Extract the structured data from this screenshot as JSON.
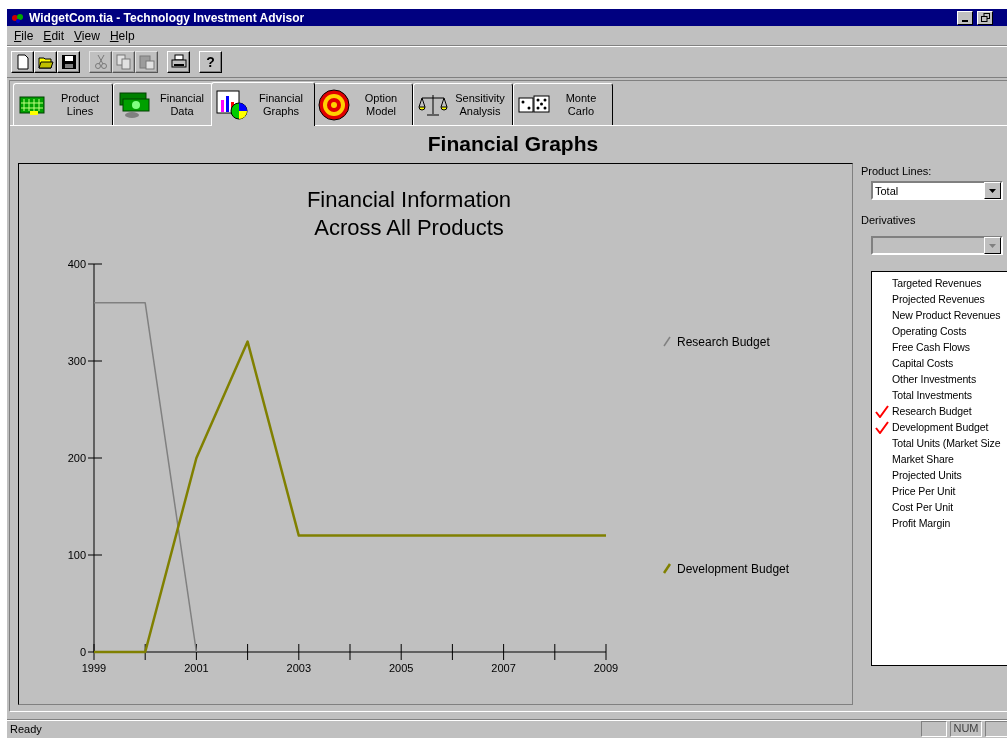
{
  "window": {
    "title": "WidgetCom.tia - Technology Investment Advisor"
  },
  "menu": [
    "File",
    "Edit",
    "View",
    "Help"
  ],
  "toolbar": [
    {
      "kind": "new",
      "disabled": false
    },
    {
      "kind": "open",
      "disabled": false
    },
    {
      "kind": "save",
      "disabled": false
    },
    {
      "kind": "sep"
    },
    {
      "kind": "cut",
      "disabled": true
    },
    {
      "kind": "copy",
      "disabled": true
    },
    {
      "kind": "paste",
      "disabled": true
    },
    {
      "kind": "sep"
    },
    {
      "kind": "print",
      "disabled": false
    },
    {
      "kind": "sep"
    },
    {
      "kind": "help",
      "label": "?",
      "disabled": false
    }
  ],
  "tabs": [
    {
      "label": "Product\nLines",
      "kind": "board",
      "selected": false
    },
    {
      "label": "Financial\nData",
      "kind": "money",
      "selected": false
    },
    {
      "label": "Financial\nGraphs",
      "kind": "graph",
      "selected": true
    },
    {
      "label": "Option\nModel",
      "kind": "target",
      "selected": false
    },
    {
      "label": "Sensitivity\nAnalysis",
      "kind": "scale",
      "selected": false
    },
    {
      "label": "Monte\nCarlo",
      "kind": "dice",
      "selected": false
    }
  ],
  "page_title": "Financial Graphs",
  "chart": {
    "chart_data": {
      "type": "line",
      "title": "Financial Information\nAcross All Products",
      "legend": "right",
      "x": [
        1999,
        2000,
        2001,
        2002,
        2003,
        2004,
        2005,
        2006,
        2007,
        2008,
        2009
      ],
      "xlim": [
        1999,
        2009
      ],
      "ylim": [
        0,
        400
      ],
      "xticks": [
        1999,
        2001,
        2003,
        2005,
        2007,
        2009
      ],
      "yticks": [
        0,
        100,
        200,
        300,
        400
      ],
      "series": [
        {
          "name": "Research Budget",
          "color": "#808080",
          "values": [
            360,
            360,
            0,
            null,
            null,
            null,
            null,
            null,
            null,
            null,
            null
          ]
        },
        {
          "name": "Development Budget",
          "color": "#808000",
          "values": [
            0,
            0,
            200,
            320,
            120,
            120,
            120,
            120,
            120,
            120,
            120
          ]
        }
      ]
    }
  },
  "side": {
    "product_lines_label": "Product Lines:",
    "product_lines_value": "Total",
    "derivatives_label": "Derivatives",
    "derivatives_disabled": true,
    "items": [
      {
        "label": "Targeted Revenues",
        "checked": false
      },
      {
        "label": "Projected Revenues",
        "checked": false
      },
      {
        "label": "New Product Revenues",
        "checked": false
      },
      {
        "label": "Operating Costs",
        "checked": false
      },
      {
        "label": "Free Cash Flows",
        "checked": false
      },
      {
        "label": "Capital Costs",
        "checked": false
      },
      {
        "label": "Other Investments",
        "checked": false
      },
      {
        "label": "Total Investments",
        "checked": false
      },
      {
        "label": "Research Budget",
        "checked": true
      },
      {
        "label": "Development Budget",
        "checked": true
      },
      {
        "label": "Total Units (Market Size",
        "checked": false
      },
      {
        "label": "Market Share",
        "checked": false
      },
      {
        "label": "Projected Units",
        "checked": false
      },
      {
        "label": "Price Per Unit",
        "checked": false
      },
      {
        "label": "Cost Per Unit",
        "checked": false
      },
      {
        "label": "Profit Margin",
        "checked": false
      }
    ]
  },
  "status_bar": {
    "message": "Ready",
    "indicators": [
      "NUM"
    ]
  }
}
